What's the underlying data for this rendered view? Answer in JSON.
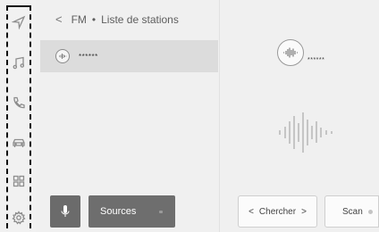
{
  "sidebar": {
    "items": [
      {
        "icon": "navigation-arrow-icon"
      },
      {
        "icon": "music-note-icon"
      },
      {
        "icon": "phone-icon"
      },
      {
        "icon": "car-icon"
      },
      {
        "icon": "apps-grid-icon"
      },
      {
        "icon": "settings-gear-icon"
      }
    ]
  },
  "header": {
    "back": "<",
    "source": "FM",
    "separator": "•",
    "title": "Liste de stations"
  },
  "stations": [
    {
      "name": "******",
      "icon": "radio-icon"
    }
  ],
  "now_playing": {
    "name": "******",
    "icon": "radio-icon"
  },
  "buttons": {
    "sources": "Sources",
    "chercher_prev": "<",
    "chercher": "Chercher",
    "chercher_next": ">",
    "scan": "Scan"
  },
  "colors": {
    "panel": "#f0f0f0",
    "selected_row": "#dcdcdc",
    "dark_button": "#6e6e6e"
  }
}
